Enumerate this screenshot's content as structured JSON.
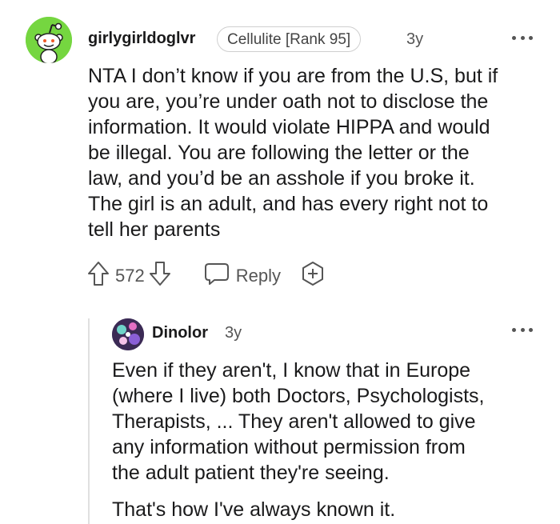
{
  "comment1": {
    "username": "girlygirldoglvr",
    "flair": "Cellulite [Rank 95]",
    "age": "3y",
    "lines": [
      "NTA I don’t know if you are from the U.S, but if",
      "you are, you’re under oath not to disclose the",
      "information. It would violate HIPPA and would",
      "be illegal. You are following the letter or the",
      "law, and you’d be an asshole if you broke it.",
      "The girl is an adult, and has every right not to",
      "tell her parents"
    ],
    "votes": "572",
    "reply_label": "Reply",
    "icons": {
      "avatar": "snoo-avatar",
      "more": "more-options-icon",
      "upvote": "upvote-arrow-icon",
      "downvote": "downvote-arrow-icon",
      "reply": "speech-bubble-icon",
      "award": "award-plus-icon"
    }
  },
  "comment2": {
    "username": "Dinolor",
    "age": "3y",
    "paragraph1_lines": [
      "Even if they aren't, I know that in Europe",
      "(where I live) both Doctors, Psychologists,",
      "Therapists, ... They aren't allowed to give",
      "any information without permission from",
      "the adult patient they're seeing."
    ],
    "paragraph2": "That's how I've always known it.",
    "icons": {
      "avatar": "dino-avatar",
      "more": "more-options-icon"
    }
  },
  "colors": {
    "avatar_green": "#75d640",
    "text": "#1a1a1b",
    "muted": "#555555",
    "flair_border": "#cfcfcf"
  }
}
